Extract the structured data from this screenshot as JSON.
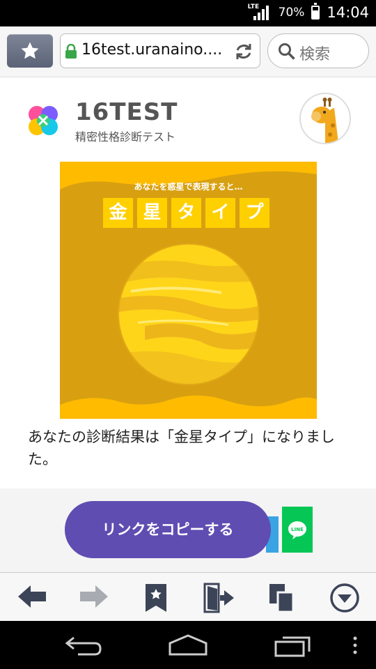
{
  "status_bar": {
    "network": "LTE",
    "battery": "70%",
    "time": "14:04"
  },
  "browser": {
    "url": "16test.uranaino....",
    "search_placeholder": "検索"
  },
  "site": {
    "title": "16TEST",
    "subtitle": "精密性格診断テスト"
  },
  "hero": {
    "tagline": "あなたを惑星で表現すると…",
    "type_chars": [
      "金",
      "星",
      "タ",
      "イ",
      "プ"
    ]
  },
  "result_text": "あなたの診断結果は「金星タイプ」になりました。",
  "share": {
    "copy_link_label": "リンクをコピーする",
    "line_label": "LINE"
  },
  "colors": {
    "hero_bg": "#d8a011",
    "accent_yellow": "#ffd000",
    "copy_button": "#5f4db2",
    "line_green": "#06c755"
  }
}
